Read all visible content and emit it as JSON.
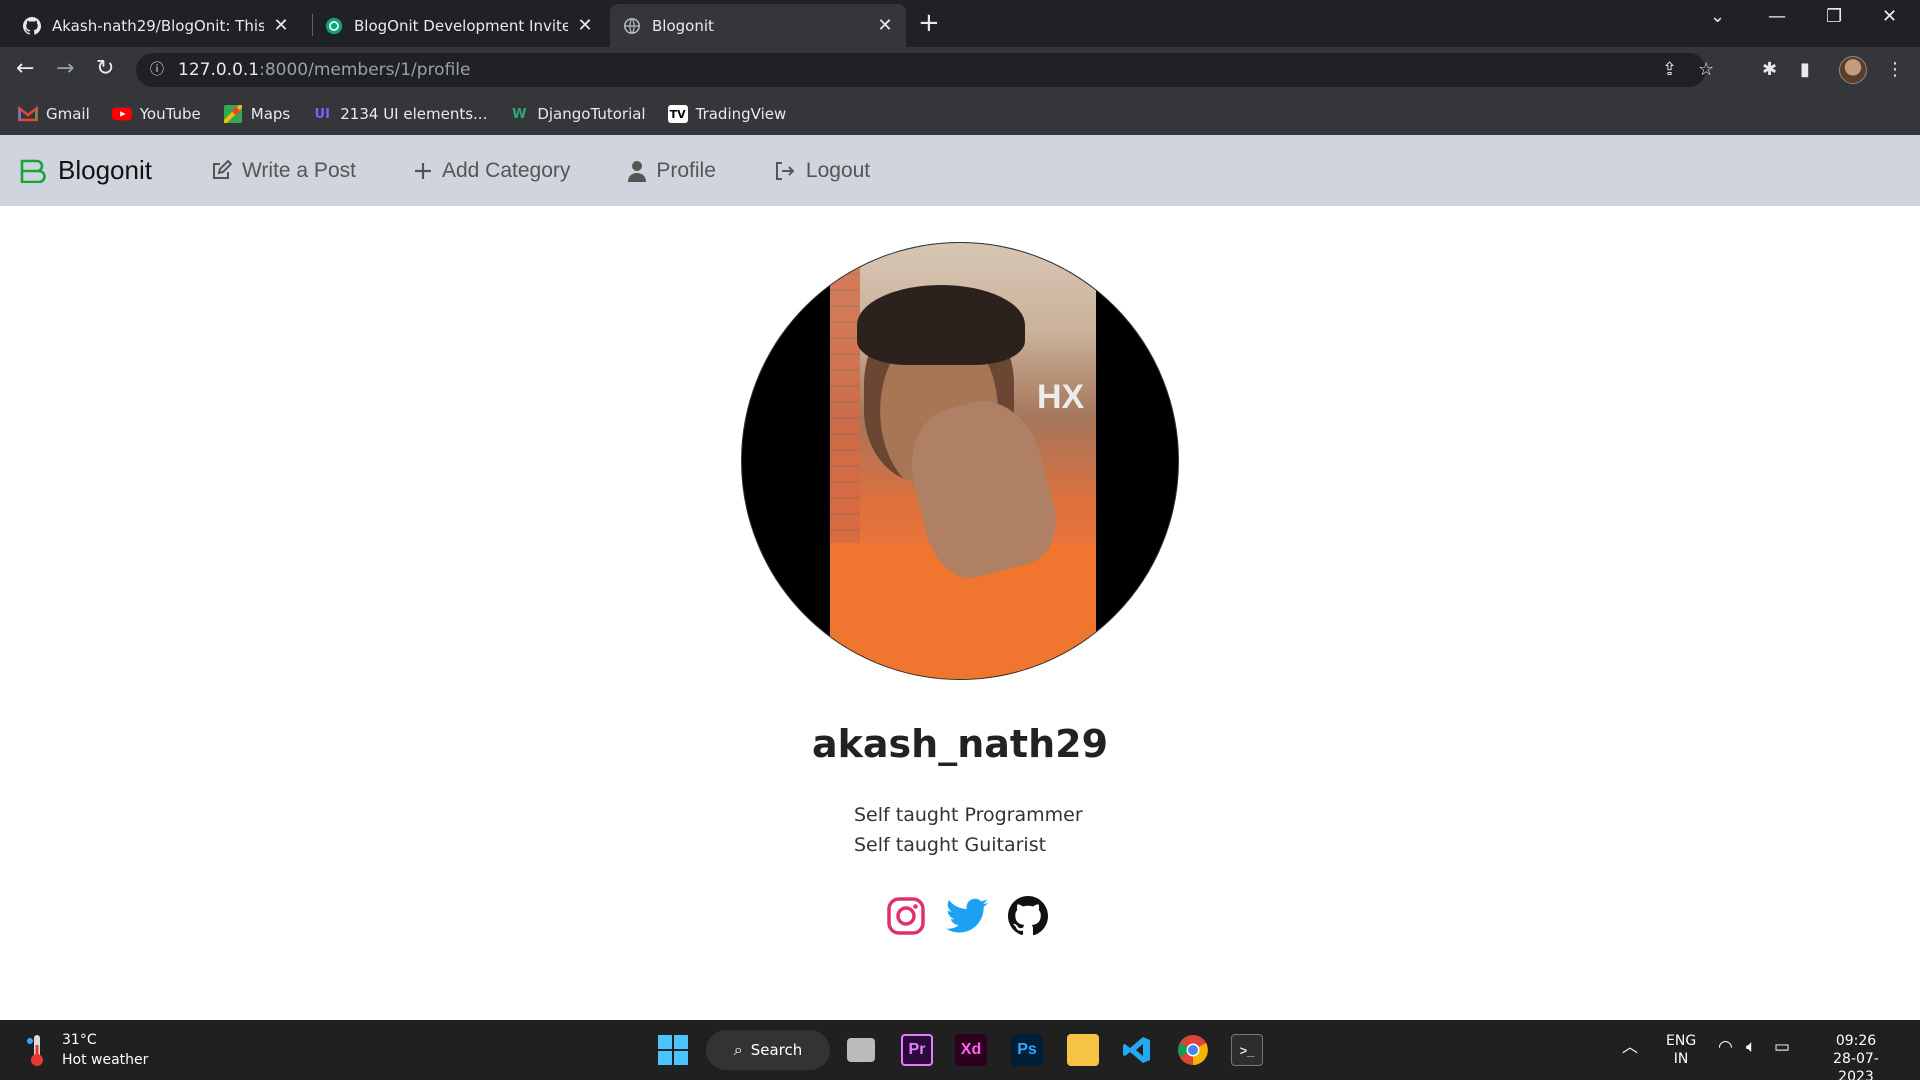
{
  "browser": {
    "tabs": [
      {
        "title": "Akash-nath29/BlogOnit: This is an",
        "icon": "github-icon"
      },
      {
        "title": "BlogOnit Development Invites Co",
        "icon": "chatgpt-icon"
      },
      {
        "title": "Blogonit",
        "icon": "globe-icon"
      }
    ],
    "url_host": "127.0.0.1",
    "url_rest": ":8000/members/1/profile",
    "bookmarks": [
      {
        "label": "Gmail",
        "icon": "gmail-icon",
        "color": "#ea4335"
      },
      {
        "label": "YouTube",
        "icon": "youtube-icon",
        "color": "#ff0000"
      },
      {
        "label": "Maps",
        "icon": "maps-icon",
        "color": "#34a853"
      },
      {
        "label": "2134 UI elements...",
        "icon": "uiverse-icon",
        "color": "#7b61ff"
      },
      {
        "label": "DjangoTutorial",
        "icon": "django-icon",
        "color": "#0c4b33"
      },
      {
        "label": "TradingView",
        "icon": "tradingview-icon",
        "color": "#000000"
      }
    ]
  },
  "site": {
    "brand": "Blogonit",
    "brand_color": "#1aa33a",
    "nav": [
      {
        "label": "Write a Post",
        "icon": "edit-icon"
      },
      {
        "label": "Add Category",
        "icon": "plus-icon"
      },
      {
        "label": "Profile",
        "icon": "user-icon"
      },
      {
        "label": "Logout",
        "icon": "logout-icon"
      }
    ]
  },
  "profile": {
    "username": "akash_nath29",
    "bio_lines": [
      "Self taught Programmer",
      "Self taught Guitarist"
    ],
    "photo_sign": "HX",
    "socials": [
      {
        "name": "instagram-icon",
        "color": "#e1306c"
      },
      {
        "name": "twitter-icon",
        "color": "#1da1f2"
      },
      {
        "name": "github-icon",
        "color": "#111111"
      }
    ]
  },
  "taskbar": {
    "temperature": "31°C",
    "weather_text": "Hot weather",
    "search_label": "Search",
    "lang_top": "ENG",
    "lang_bottom": "IN",
    "time": "09:26",
    "date": "28-07-2023"
  }
}
